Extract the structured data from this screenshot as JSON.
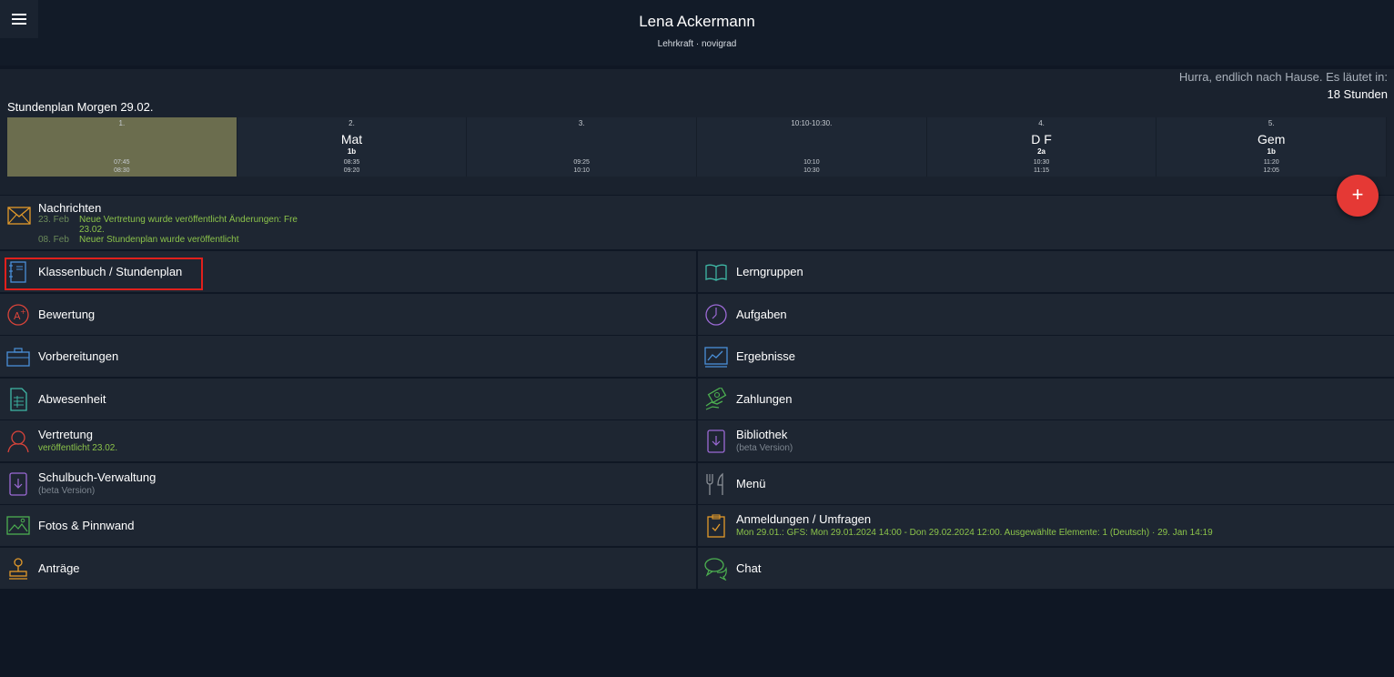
{
  "header": {
    "name": "Lena Ackermann",
    "subtitle": "Lehrkraft · novigrad"
  },
  "countdown": {
    "text": "Hurra, endlich nach Hause. Es läutet in:",
    "hours": "18 Stunden"
  },
  "timetable": {
    "title": "Stundenplan Morgen 29.02.",
    "periods": [
      {
        "num": "1.",
        "subject": "",
        "class": "",
        "start": "07:45",
        "end": "08:30"
      },
      {
        "num": "2.",
        "subject": "Mat",
        "class": "1b",
        "start": "08:35",
        "end": "09:20"
      },
      {
        "num": "3.",
        "subject": "",
        "class": "",
        "start": "09:25",
        "end": "10:10"
      },
      {
        "num": "10:10-10:30.",
        "subject": "",
        "class": "",
        "start": "10:10",
        "end": "10:30"
      },
      {
        "num": "4.",
        "subject": "D F",
        "class": "2a",
        "start": "10:30",
        "end": "11:15"
      },
      {
        "num": "5.",
        "subject": "Gem",
        "class": "1b",
        "start": "11:20",
        "end": "12:05"
      }
    ]
  },
  "fab": {
    "label": "+"
  },
  "news": {
    "title": "Nachrichten",
    "items": [
      {
        "date": "23. Feb",
        "text": "Neue Vertretung wurde veröffentlicht Änderungen: Fre 23.02."
      },
      {
        "date": "08. Feb",
        "text": "Neuer Stundenplan wurde veröffentlicht"
      }
    ]
  },
  "menu": {
    "klassenbuch": {
      "label": "Klassenbuch / Stundenplan"
    },
    "lerngruppen": {
      "label": "Lerngruppen"
    },
    "bewertung": {
      "label": "Bewertung"
    },
    "aufgaben": {
      "label": "Aufgaben"
    },
    "vorbereitungen": {
      "label": "Vorbereitungen"
    },
    "ergebnisse": {
      "label": "Ergebnisse"
    },
    "abwesenheit": {
      "label": "Abwesenheit"
    },
    "zahlungen": {
      "label": "Zahlungen"
    },
    "vertretung": {
      "label": "Vertretung",
      "sub": "veröffentlicht 23.02."
    },
    "bibliothek": {
      "label": "Bibliothek",
      "sub": "(beta Version)"
    },
    "schulbuch": {
      "label": "Schulbuch-Verwaltung",
      "sub": "(beta Version)"
    },
    "menue": {
      "label": "Menü"
    },
    "fotos": {
      "label": "Fotos & Pinnwand"
    },
    "anmeldungen": {
      "label": "Anmeldungen / Umfragen",
      "sub": "Mon 29.01.: GFS: Mon 29.01.2024 14:00 - Don 29.02.2024 12:00. Ausgewählte Elemente: 1 (Deutsch) · 29. Jan 14:19"
    },
    "antraege": {
      "label": "Anträge"
    },
    "chat": {
      "label": "Chat"
    }
  },
  "colors": {
    "background": "#0f1724",
    "panel": "#1e2632",
    "accent_green": "#8bc34a",
    "fab_red": "#e53935",
    "highlight_red": "#e0201c",
    "current_period": "#6b6d4e"
  }
}
